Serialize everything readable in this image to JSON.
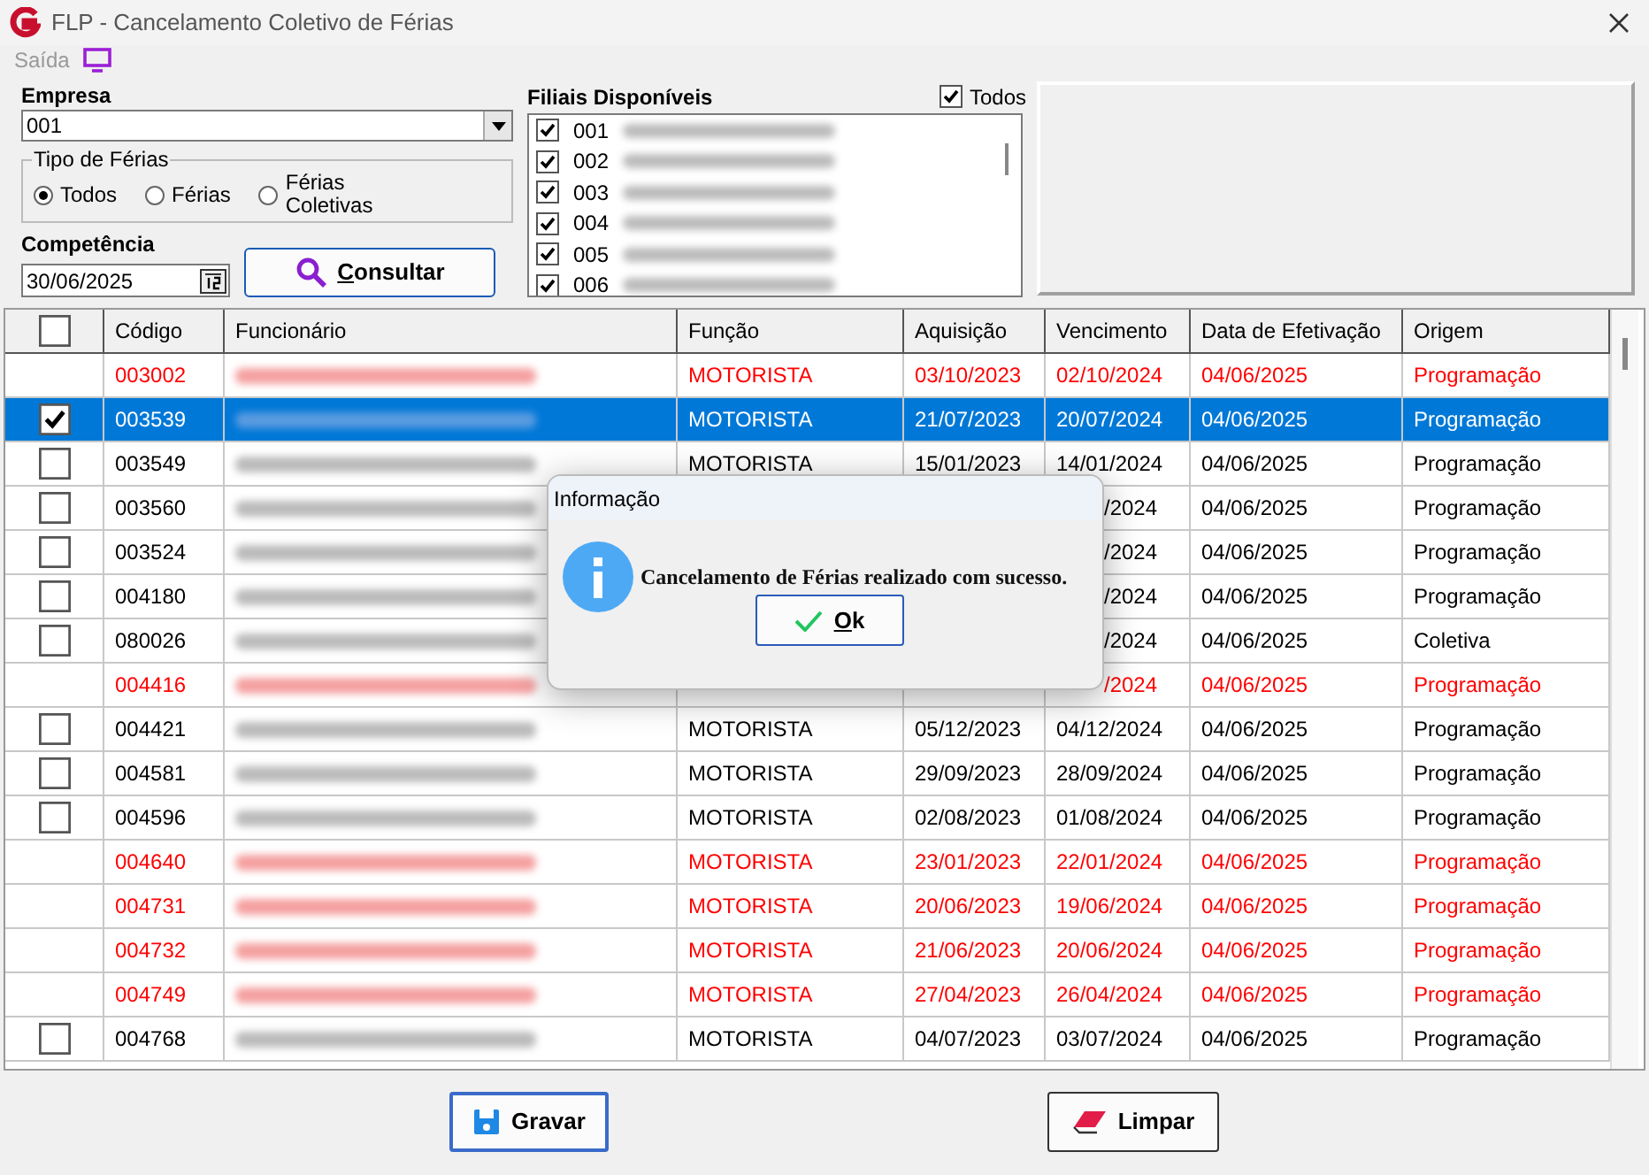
{
  "window": {
    "title": "FLP - Cancelamento Coletivo de Férias"
  },
  "menu": [
    {
      "label": "Saída"
    }
  ],
  "empresa": {
    "label": "Empresa",
    "value": "001"
  },
  "tipo_de_ferias": {
    "label": "Tipo de Férias",
    "options": [
      {
        "label": "Todos",
        "selected": true
      },
      {
        "label": "Férias",
        "selected": false
      },
      {
        "label": "Férias Coletivas",
        "selected": false
      }
    ]
  },
  "competencia": {
    "label": "Competência",
    "value": "30/06/2025"
  },
  "consultar_button": {
    "label": "Consultar"
  },
  "filiais": {
    "label": "Filiais Disponíveis",
    "all": {
      "label": "Todos",
      "checked": true
    },
    "items": [
      {
        "code": "001",
        "checked": true
      },
      {
        "code": "002",
        "checked": true
      },
      {
        "code": "003",
        "checked": true
      },
      {
        "code": "004",
        "checked": true
      },
      {
        "code": "005",
        "checked": true
      },
      {
        "code": "006",
        "checked": true
      }
    ]
  },
  "table": {
    "header_checked": false,
    "columns": [
      "Código",
      "Funcionário",
      "Função",
      "Aquisição",
      "Vencimento",
      "Data de Efetivação",
      "Origem"
    ],
    "rows": [
      {
        "kind": "done",
        "selected": false,
        "codigo": "003002",
        "funcao": "MOTORISTA",
        "aquisicao": "03/10/2023",
        "vencimento": "02/10/2024",
        "efetivacao": "04/06/2025",
        "origem": "Programação"
      },
      {
        "kind": "open",
        "checked": true,
        "selected": true,
        "codigo": "003539",
        "funcao": "MOTORISTA",
        "aquisicao": "21/07/2023",
        "vencimento": "20/07/2024",
        "efetivacao": "04/06/2025",
        "origem": "Programação"
      },
      {
        "kind": "open",
        "checked": false,
        "selected": false,
        "codigo": "003549",
        "funcao": "MOTORISTA",
        "aquisicao": "15/01/2023",
        "vencimento": "14/01/2024",
        "efetivacao": "04/06/2025",
        "origem": "Programação"
      },
      {
        "kind": "open",
        "checked": false,
        "selected": false,
        "codigo": "003560",
        "vencimento": "/2024",
        "efetivacao": "04/06/2025",
        "origem": "Programação"
      },
      {
        "kind": "open",
        "checked": false,
        "selected": false,
        "codigo": "003524",
        "vencimento": "/2024",
        "efetivacao": "04/06/2025",
        "origem": "Programação"
      },
      {
        "kind": "open",
        "checked": false,
        "selected": false,
        "codigo": "004180",
        "vencimento": "/2024",
        "efetivacao": "04/06/2025",
        "origem": "Programação"
      },
      {
        "kind": "open",
        "checked": false,
        "selected": false,
        "codigo": "080026",
        "vencimento": "/2024",
        "efetivacao": "04/06/2025",
        "origem": "Coletiva"
      },
      {
        "kind": "done",
        "selected": false,
        "codigo": "004416",
        "vencimento": "/2024",
        "efetivacao": "04/06/2025",
        "origem": "Programação"
      },
      {
        "kind": "open",
        "checked": false,
        "selected": false,
        "codigo": "004421",
        "funcao": "MOTORISTA",
        "aquisicao": "05/12/2023",
        "vencimento": "04/12/2024",
        "efetivacao": "04/06/2025",
        "origem": "Programação"
      },
      {
        "kind": "open",
        "checked": false,
        "selected": false,
        "codigo": "004581",
        "funcao": "MOTORISTA",
        "aquisicao": "29/09/2023",
        "vencimento": "28/09/2024",
        "efetivacao": "04/06/2025",
        "origem": "Programação"
      },
      {
        "kind": "open",
        "checked": false,
        "selected": false,
        "codigo": "004596",
        "funcao": "MOTORISTA",
        "aquisicao": "02/08/2023",
        "vencimento": "01/08/2024",
        "efetivacao": "04/06/2025",
        "origem": "Programação"
      },
      {
        "kind": "done",
        "selected": false,
        "codigo": "004640",
        "funcao": "MOTORISTA",
        "aquisicao": "23/01/2023",
        "vencimento": "22/01/2024",
        "efetivacao": "04/06/2025",
        "origem": "Programação"
      },
      {
        "kind": "done",
        "selected": false,
        "codigo": "004731",
        "funcao": "MOTORISTA",
        "aquisicao": "20/06/2023",
        "vencimento": "19/06/2024",
        "efetivacao": "04/06/2025",
        "origem": "Programação"
      },
      {
        "kind": "done",
        "selected": false,
        "codigo": "004732",
        "funcao": "MOTORISTA",
        "aquisicao": "21/06/2023",
        "vencimento": "20/06/2024",
        "efetivacao": "04/06/2025",
        "origem": "Programação"
      },
      {
        "kind": "done",
        "selected": false,
        "codigo": "004749",
        "funcao": "MOTORISTA",
        "aquisicao": "27/04/2023",
        "vencimento": "26/04/2024",
        "efetivacao": "04/06/2025",
        "origem": "Programação"
      },
      {
        "kind": "open",
        "checked": false,
        "selected": false,
        "codigo": "004768",
        "funcao": "MOTORISTA",
        "aquisicao": "04/07/2023",
        "vencimento": "03/07/2024",
        "efetivacao": "04/06/2025",
        "origem": "Programação"
      }
    ]
  },
  "dialog": {
    "title": "Informação",
    "message": "Cancelamento de Férias realizado com sucesso.",
    "button": "Ok"
  },
  "buttons": [
    {
      "label": "Gravar",
      "kind": "save"
    },
    {
      "label": "Limpar",
      "kind": "clear"
    }
  ]
}
